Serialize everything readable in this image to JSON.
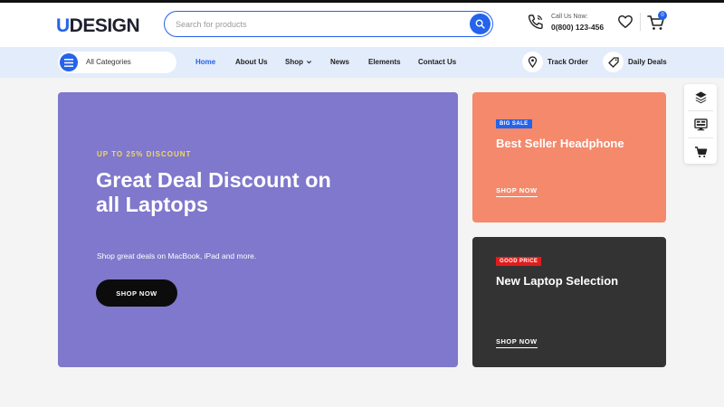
{
  "header": {
    "logo_accent": "U",
    "logo_rest": "DESIGN",
    "search_placeholder": "Search for products",
    "call_label": "Call Us Now:",
    "call_number": "0(800) 123-456",
    "cart_count": "0"
  },
  "nav": {
    "categories_label": "All Categories",
    "items": [
      {
        "label": "Home",
        "active": true
      },
      {
        "label": "About Us"
      },
      {
        "label": "Shop"
      },
      {
        "label": "News"
      },
      {
        "label": "Elements"
      },
      {
        "label": "Contact Us"
      }
    ],
    "track_order": "Track Order",
    "daily_deals": "Daily Deals"
  },
  "hero": {
    "kicker": "UP TO 25% DISCOUNT",
    "title": "Great Deal Discount on all Laptops",
    "subtitle": "Shop great deals on MacBook, iPad and more.",
    "button": "SHOP NOW"
  },
  "promos": [
    {
      "badge": "BIG SALE",
      "title": "Best Seller Headphone",
      "link": "SHOP NOW"
    },
    {
      "badge": "GOOD PRICE",
      "title": "New Laptop Selection",
      "link": "SHOP NOW"
    }
  ],
  "side_panel": {
    "icons": [
      "layers-icon",
      "demos-icon",
      "cart-icon"
    ]
  },
  "colors": {
    "accent": "#2463eb",
    "hero_bg": "#7f78cc",
    "promo1_bg": "#f4896c",
    "promo2_bg": "#333333",
    "kicker": "#f3d95c",
    "badge_red": "#e41b1b"
  }
}
